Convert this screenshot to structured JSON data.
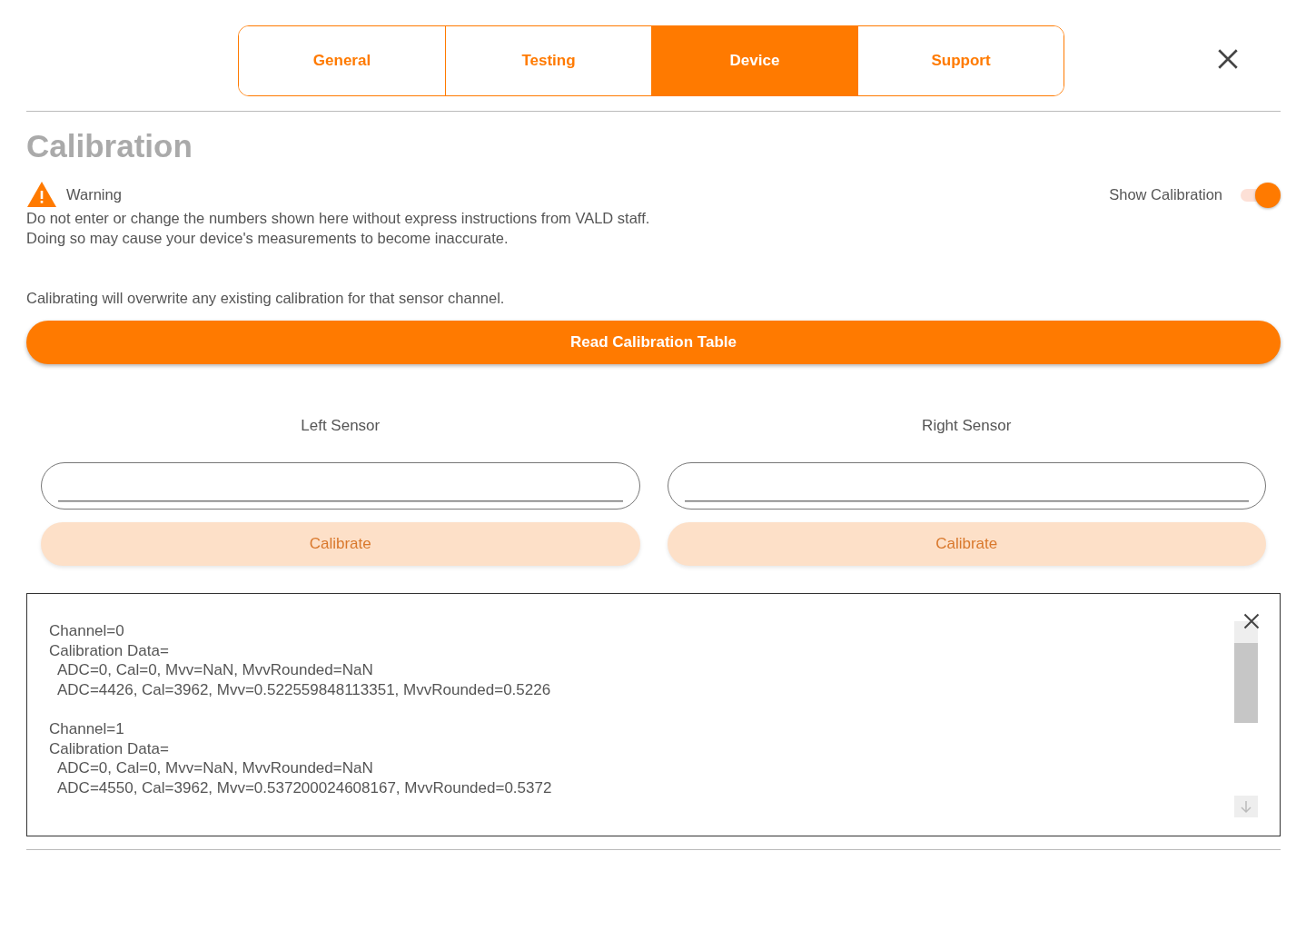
{
  "tabs": [
    {
      "label": "General",
      "selected": false
    },
    {
      "label": "Testing",
      "selected": false
    },
    {
      "label": "Device",
      "selected": true
    },
    {
      "label": "Support",
      "selected": false
    }
  ],
  "section_title": "Calibration",
  "warning": {
    "label": "Warning",
    "lines": [
      "Do not enter or change the numbers shown here without express instructions from VALD staff.",
      "Doing so may cause your device's measurements to become inaccurate."
    ]
  },
  "show_calibration": {
    "label": "Show Calibration",
    "on": true
  },
  "note": "Calibrating will overwrite any existing calibration for that sensor channel.",
  "read_button": "Read Calibration Table",
  "sensors": [
    {
      "label": "Left Sensor",
      "button": "Calibrate",
      "disabled": true
    },
    {
      "label": "Right Sensor",
      "button": "Calibrate",
      "disabled": true
    }
  ],
  "log": [
    {
      "channel": "Channel=0",
      "heading": "Calibration Data=",
      "rows": [
        "ADC=0, Cal=0, Mvv=NaN, MvvRounded=NaN",
        "ADC=4426, Cal=3962, Mvv=0.522559848113351, MvvRounded=0.5226"
      ]
    },
    {
      "channel": "Channel=1",
      "heading": "Calibration Data=",
      "rows": [
        "ADC=0, Cal=0, Mvv=NaN, MvvRounded=NaN",
        "ADC=4550, Cal=3962, Mvv=0.537200024608167, MvvRounded=0.5372"
      ]
    }
  ]
}
